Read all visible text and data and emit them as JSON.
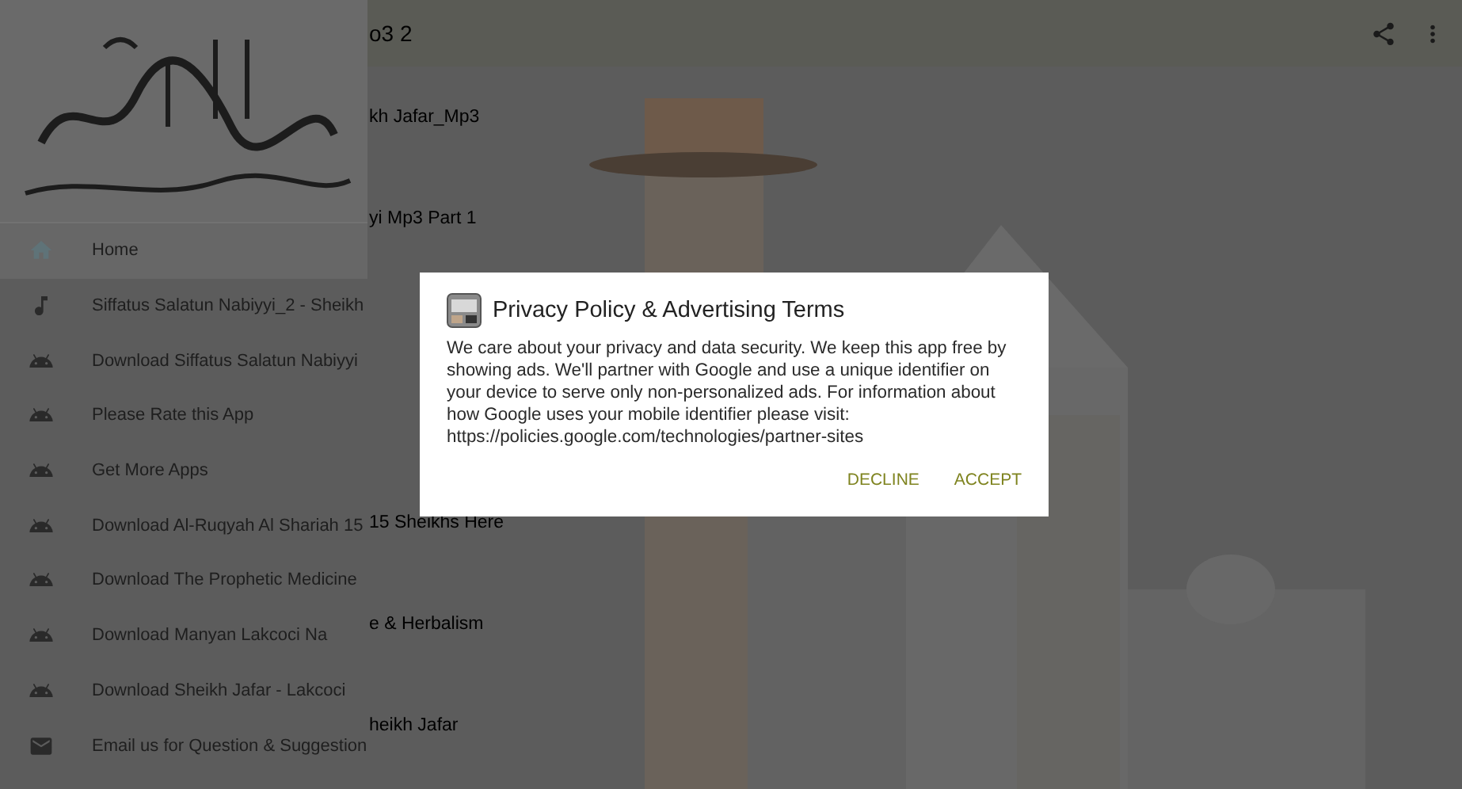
{
  "toolbar": {
    "title": "o3 2"
  },
  "drawer": {
    "items": [
      {
        "label": "Home",
        "kind": "home",
        "selected": true
      },
      {
        "label": "Siffatus Salatun Nabiyyi_2 - Sheikh",
        "kind": "audio",
        "selected": false
      },
      {
        "label": "Download Siffatus Salatun Nabiyyi",
        "kind": "app",
        "selected": false
      },
      {
        "label": "Please Rate this App",
        "kind": "app",
        "selected": false
      },
      {
        "label": "Get More Apps",
        "kind": "app",
        "selected": false
      },
      {
        "label": "Download Al-Ruqyah Al Shariah 15",
        "kind": "app",
        "selected": false
      },
      {
        "label": "Download The Prophetic Medicine",
        "kind": "app",
        "selected": false
      },
      {
        "label": "Download Manyan Lakcoci Na",
        "kind": "app",
        "selected": false
      },
      {
        "label": "Download Sheikh Jafar - Lakcoci",
        "kind": "app",
        "selected": false
      },
      {
        "label": "Email us for Question & Suggestion",
        "kind": "email",
        "selected": false
      }
    ]
  },
  "list": {
    "items": [
      "kh Jafar_Mp3",
      "yi Mp3 Part 1",
      "15 Sheikhs Here",
      "e & Herbalism",
      "heikh Jafar"
    ]
  },
  "dialog": {
    "title": "Privacy Policy & Advertising Terms",
    "body": "We care about your privacy and data security. We keep this app free by showing ads. We'll partner with Google and use a unique identifier on your device to serve only non-personalized ads. For information about how Google uses your mobile identifier please visit: https://policies.google.com/technologies/partner-sites",
    "buttons": [
      "DECLINE",
      "ACCEPT"
    ]
  }
}
